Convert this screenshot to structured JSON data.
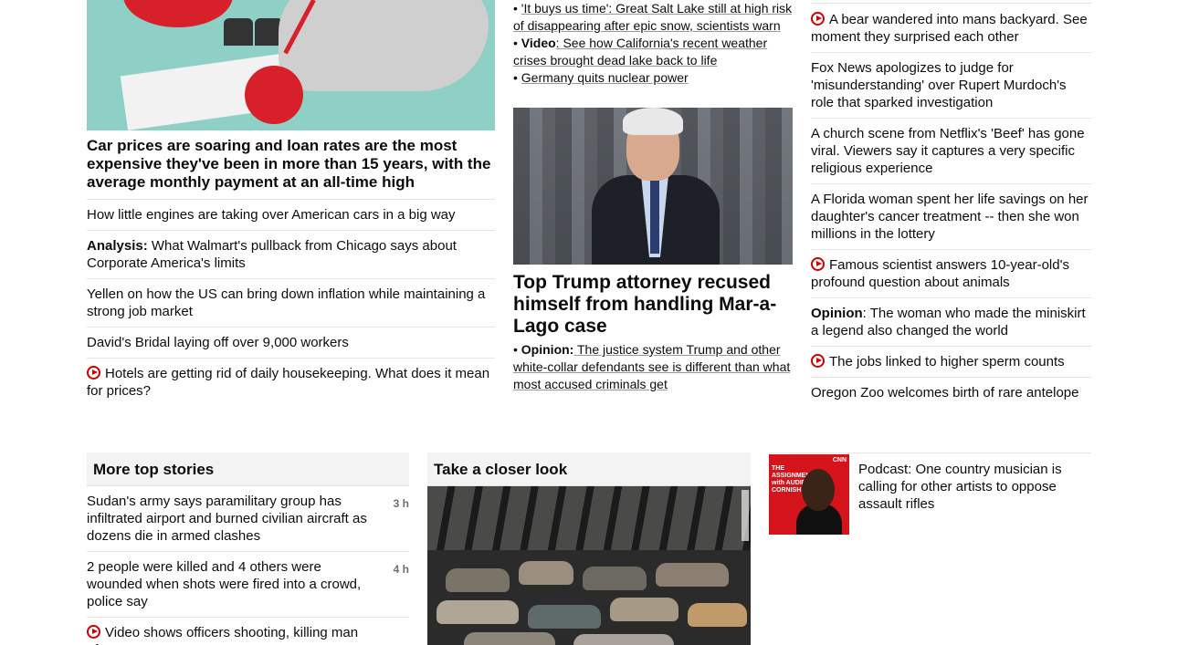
{
  "col1": {
    "headline": "Car prices are soaring and loan rates are the most expensive they've been in more than 15 years, with the average monthly payment at an all-time high",
    "items": [
      {
        "prefix": "",
        "text": "How little engines are taking over American cars in a big way",
        "video": false
      },
      {
        "prefix": "Analysis:",
        "text": " What Walmart's pullback from Chicago says about Corporate America's limits",
        "video": false
      },
      {
        "prefix": "",
        "text": "Yellen on how the US can bring down inflation while maintaining a strong job market",
        "video": false
      },
      {
        "prefix": "",
        "text": "David's Bridal laying off over 9,000 workers",
        "video": false
      },
      {
        "prefix": "",
        "text": "Hotels are getting rid of daily housekeeping. What does it mean for prices?",
        "video": true
      }
    ]
  },
  "col2": {
    "bullets_top": [
      {
        "bullet": "•",
        "prefix": "",
        "text": "'It buys us time': Great Salt Lake still at high risk of disappearing after epic snow, scientists warn"
      },
      {
        "bullet": "•",
        "prefix": "Video",
        "text": ": See how California's recent weather crises brought dead lake back to life"
      },
      {
        "bullet": "•",
        "prefix": "",
        "text": "Germany quits nuclear power"
      }
    ],
    "headline": "Top Trump attorney recused himself from handling Mar-a-Lago case",
    "sub": {
      "bullet": "•",
      "prefix": "Opinion:",
      "text": " The justice system Trump and other white-collar defendants see is different than what most accused criminals get"
    }
  },
  "col3": {
    "items": [
      {
        "prefix": "",
        "text": "A bear wandered into mans backyard. See moment they surprised each other",
        "video": true
      },
      {
        "prefix": "",
        "text": "Fox News apologizes to judge for 'misunderstanding' over Rupert Murdoch's role that sparked investigation",
        "video": false
      },
      {
        "prefix": "",
        "text": "A church scene from Netflix's 'Beef' has gone viral. Viewers say it captures a very specific religious experience",
        "video": false
      },
      {
        "prefix": "",
        "text": "A Florida woman spent her life savings on her daughter's cancer treatment -- then she won millions in the lottery",
        "video": false
      },
      {
        "prefix": "",
        "text": "Famous scientist answers 10-year-old's profound question about animals",
        "video": true
      },
      {
        "prefix": "Opinion",
        "text": ": The woman who made the miniskirt a legend also changed the world",
        "video": false
      },
      {
        "prefix": "",
        "text": "The jobs linked to higher sperm counts",
        "video": true
      },
      {
        "prefix": "",
        "text": "Oregon Zoo welcomes birth of rare antelope",
        "video": false
      }
    ]
  },
  "more_top_stories": {
    "title": "More top stories",
    "stories": [
      {
        "text": "Sudan's army says paramilitary group has infiltrated airport and burned civilian aircraft as dozens die in armed clashes",
        "time": "3 h",
        "video": false
      },
      {
        "text": "2 people were killed and 4 others were wounded when shots were fired into a crowd, police say",
        "time": "4 h",
        "video": false
      },
      {
        "text": "Video shows officers shooting, killing man after",
        "time": "",
        "video": true
      }
    ]
  },
  "closer_look": {
    "title": "Take a closer look"
  },
  "podcast": {
    "text": "Podcast: One country musician is calling for other artists to oppose assault rifles",
    "image_title": "THE ASSIGNMENT with AUDIE CORNISH",
    "image_logo": "CNN"
  }
}
